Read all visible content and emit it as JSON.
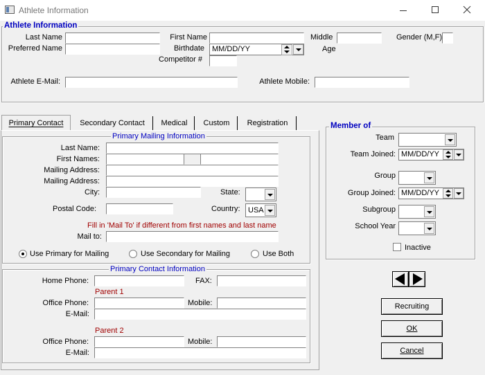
{
  "window": {
    "title": "Athlete Information"
  },
  "athlete": {
    "group_title": "Athlete Information",
    "last_name_label": "Last Name",
    "first_name_label": "First Name",
    "middle_label": "Middle",
    "gender_label": "Gender (M,F):",
    "preferred_name_label": "Preferred Name",
    "birthdate_label": "Birthdate",
    "birthdate_value": "MM/DD/YY",
    "age_label": "Age",
    "competitor_label": "Competitor #",
    "email_label": "Athlete E-Mail:",
    "mobile_label": "Athlete Mobile:"
  },
  "tabs": [
    {
      "label": "Primary Contact"
    },
    {
      "label": "Secondary Contact"
    },
    {
      "label": "Medical"
    },
    {
      "label": "Custom"
    },
    {
      "label": "Registration"
    }
  ],
  "primary_mailing": {
    "title": "Primary Mailing Information",
    "last_name": "Last Name:",
    "first_names": "First Names:",
    "mailing_address_1": "Mailing Address:",
    "mailing_address_2": "Mailing Address:",
    "city": "City:",
    "state": "State:",
    "postal_code": "Postal Code:",
    "country": "Country:",
    "country_value": "USA",
    "mail_to_note": "Fill in 'Mail To' if different from first names and last name",
    "mail_to": "Mail to:",
    "radio_primary": "Use Primary for Mailing",
    "radio_secondary": "Use Secondary for Mailing",
    "radio_both": "Use Both"
  },
  "primary_contact": {
    "title": "Primary Contact Information",
    "home_phone": "Home Phone:",
    "fax": "FAX:",
    "parent1": "Parent 1",
    "office_phone_1": "Office Phone:",
    "mobile_1": "Mobile:",
    "email_1": "E-Mail:",
    "parent2": "Parent 2",
    "office_phone_2": "Office Phone:",
    "mobile_2": "Mobile:",
    "email_2": "E-Mail:"
  },
  "member_of": {
    "title": "Member of",
    "team": "Team",
    "team_joined": "Team Joined:",
    "team_joined_value": "MM/DD/YY",
    "group": "Group",
    "group_joined": "Group Joined:",
    "group_joined_value": "MM/DD/YY",
    "subgroup": "Subgroup",
    "school_year": "School Year",
    "inactive": "Inactive"
  },
  "buttons": {
    "recruiting": "Recruiting",
    "ok": "OK",
    "cancel": "Cancel"
  },
  "colors": {
    "group_title": "#0000c0",
    "note": "#a00000"
  }
}
